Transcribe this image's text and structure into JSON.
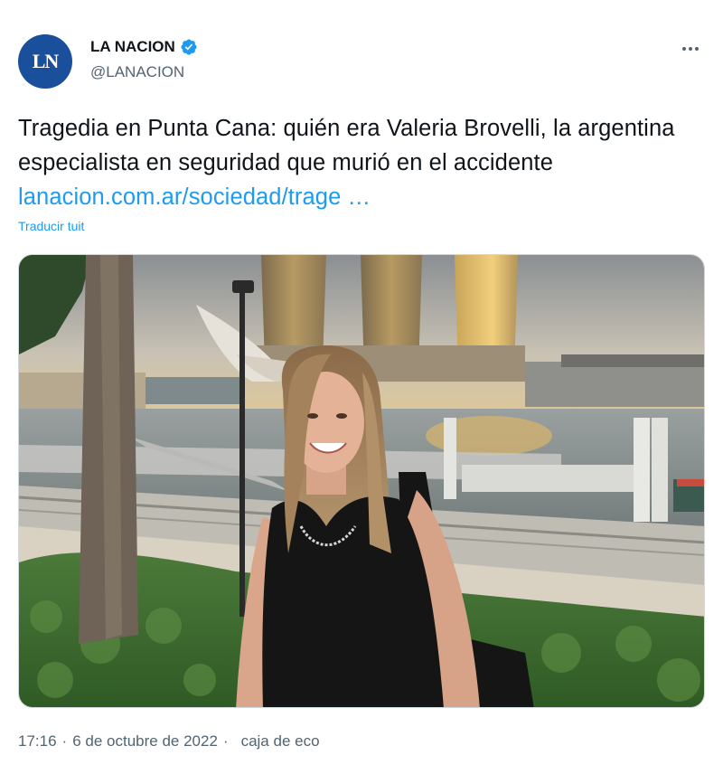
{
  "author": {
    "avatar_initials": "LN",
    "name": "LA NACION",
    "handle": "@LANACION",
    "verified": true
  },
  "tweet": {
    "text": "Tragedia en Punta Cana: quién era Valeria Brovelli, la argentina especialista en seguridad que murió en el accidente",
    "link_text": "lanacion.com.ar/sociedad/trage …",
    "translate_label": "Traducir tuit"
  },
  "meta": {
    "time": "17:16",
    "separator": "·",
    "date": "6 de octubre de 2022",
    "source": "caja de eco"
  },
  "icons": {
    "more": "more-horizontal-icon",
    "verified": "verified-badge-icon"
  },
  "colors": {
    "link": "#1d9bf0",
    "secondary_text": "#536471",
    "avatar_bg": "#1a4f9c"
  }
}
